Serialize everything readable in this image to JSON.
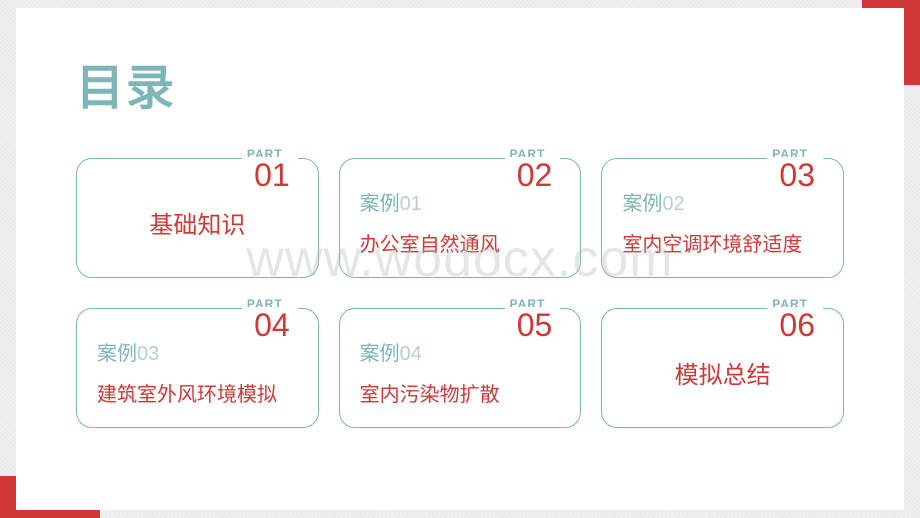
{
  "title": "目录",
  "watermark": "www.wodocx.com",
  "cards": [
    {
      "part_label": "PART",
      "part_number": "01",
      "case_label": "",
      "case_num": "",
      "desc": "基础知识",
      "centered": true
    },
    {
      "part_label": "PART",
      "part_number": "02",
      "case_label": "案例",
      "case_num": "01",
      "desc": "办公室自然通风",
      "centered": false
    },
    {
      "part_label": "PART",
      "part_number": "03",
      "case_label": "案例",
      "case_num": "02",
      "desc": "室内空调环境舒适度",
      "centered": false
    },
    {
      "part_label": "PART",
      "part_number": "04",
      "case_label": "案例",
      "case_num": "03",
      "desc": "建筑室外风环境模拟",
      "centered": false
    },
    {
      "part_label": "PART",
      "part_number": "05",
      "case_label": "案例",
      "case_num": "04",
      "desc": "室内污染物扩散",
      "centered": false
    },
    {
      "part_label": "PART",
      "part_number": "06",
      "case_label": "",
      "case_num": "",
      "desc": "模拟总结",
      "centered": true
    }
  ]
}
